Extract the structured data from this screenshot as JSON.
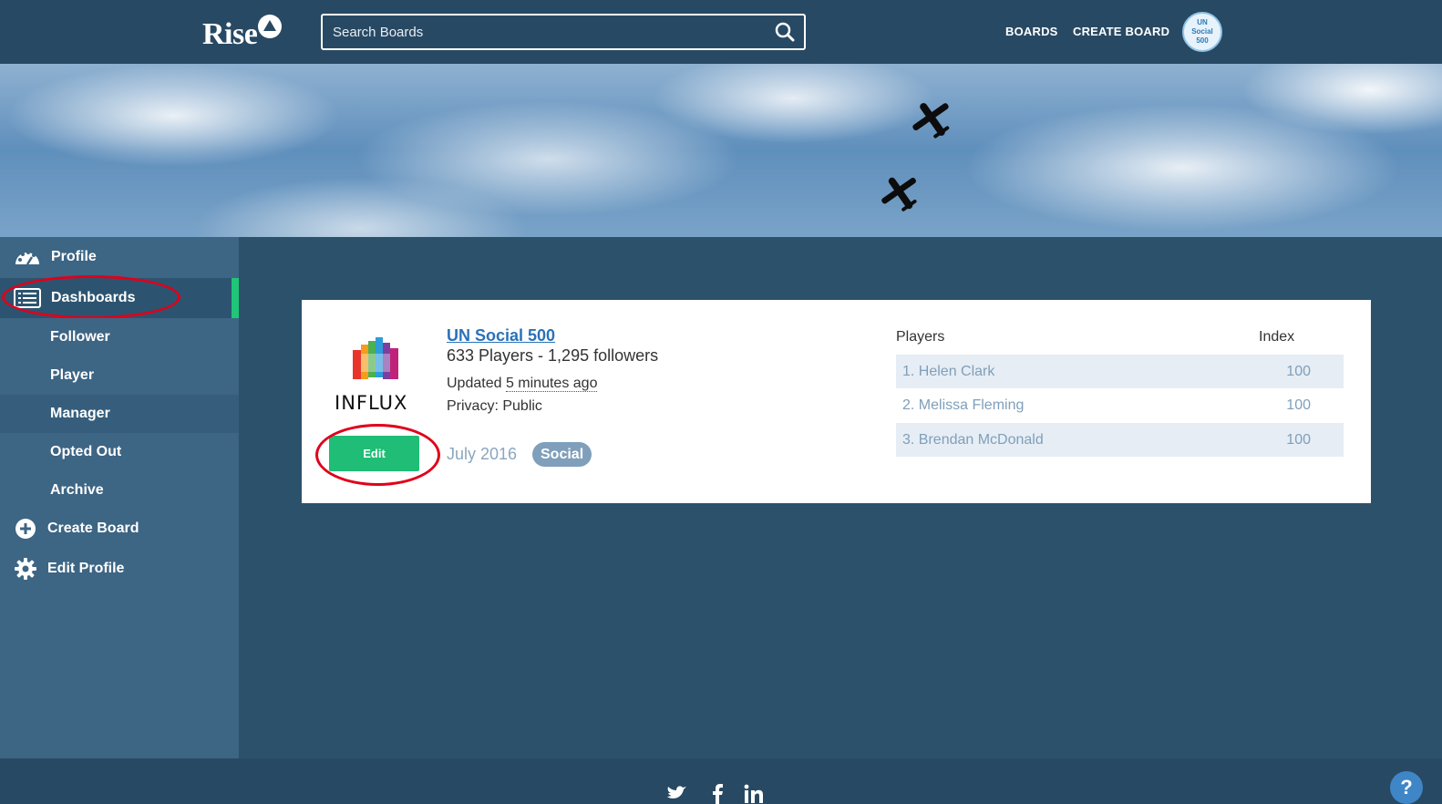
{
  "header": {
    "logo_text": "Rise",
    "search_placeholder": "Search Boards",
    "nav": {
      "boards": "BOARDS",
      "create_board": "CREATE BOARD"
    },
    "avatar_lines": [
      "UN",
      "Social",
      "500"
    ]
  },
  "sidebar": {
    "profile": "Profile",
    "dashboards": "Dashboards",
    "sub_items": [
      "Follower",
      "Player",
      "Manager",
      "Opted Out",
      "Archive"
    ],
    "create_board": "Create Board",
    "edit_profile": "Edit Profile"
  },
  "board": {
    "logo_label": "INFLUX",
    "edit_label": "Edit",
    "title": "UN Social 500",
    "stats": "633 Players - 1,295 followers",
    "updated_prefix": "Updated",
    "updated_ago": "5 minutes ago",
    "privacy": "Privacy: Public",
    "date": "July 2016",
    "tag": "Social"
  },
  "leaderboard": {
    "header_players": "Players",
    "header_index": "Index",
    "rows": [
      {
        "name": "1. Helen Clark",
        "index": "100"
      },
      {
        "name": "2. Melissa Fleming",
        "index": "100"
      },
      {
        "name": "3. Brendan McDonald",
        "index": "100"
      }
    ]
  },
  "footer": {
    "help": "?"
  },
  "colors": {
    "accent_green": "#1fbd75",
    "link_blue": "#2a72b8",
    "annotation_red": "#e0001a",
    "navbar": "#284963"
  }
}
